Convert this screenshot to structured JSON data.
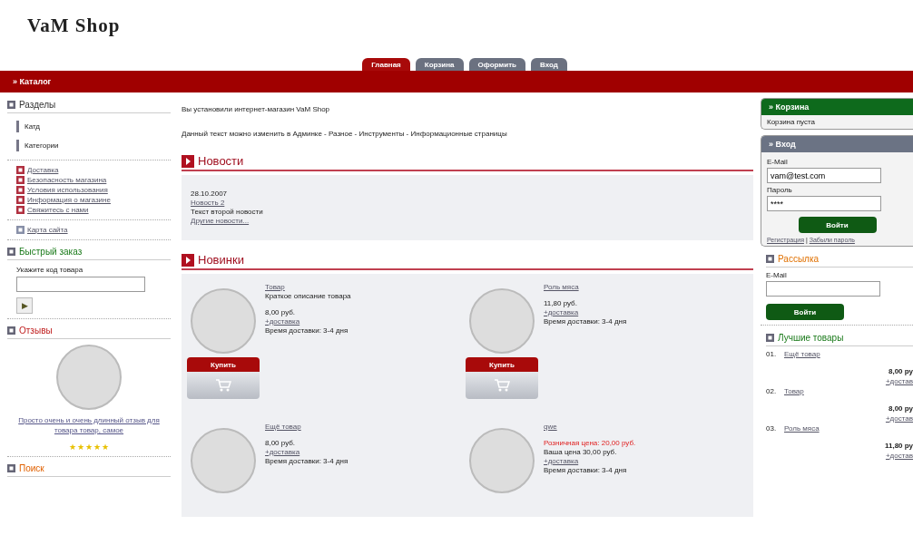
{
  "logo": "VaM Shop",
  "tabs": [
    {
      "label": "Главная",
      "selected": true
    },
    {
      "label": "Корзина",
      "selected": false
    },
    {
      "label": "Оформить",
      "selected": false
    },
    {
      "label": "Вход",
      "selected": false
    }
  ],
  "catalog_bar": "» Каталог",
  "left": {
    "sections_title": "Разделы",
    "categories": [
      "Катд",
      "Категории"
    ],
    "info_links": [
      "Доставка",
      "Безопасность магазина",
      "Условия использования",
      "Информация о магазине",
      "Свяжитесь с нами"
    ],
    "sitemap": "Карта сайта",
    "quick_order": {
      "title": "Быстрый заказ",
      "label": "Укажите код товара",
      "button": "▶"
    },
    "reviews": {
      "title": "Отзывы",
      "text": "Просто очень и очень длинный отзыв для товара товар, самое",
      "stars": 5
    },
    "search_title": "Поиск"
  },
  "center": {
    "intro": [
      "Вы установили интернет-магазин VaM Shop",
      "Данный текст можно изменить в Админке - Разное - Инструменты - Информационные страницы"
    ],
    "news": {
      "title": "Новости",
      "date": "28.10.2007",
      "headline": "Новость 2",
      "text": "Текст второй новости",
      "more": "Другие новости..."
    },
    "new_products": {
      "title": "Новинки",
      "items": [
        {
          "name": "Товар",
          "description": "Краткое описание товара",
          "price": "8,00 руб.",
          "shipping": "+доставка",
          "delivery": "Время доставки:  3-4 дня",
          "buy": "Купить"
        },
        {
          "name": "Роль мяса",
          "price": "11,80 руб.",
          "shipping": "+доставка",
          "delivery": "Время доставки:  3-4 дня",
          "buy": "Купить"
        },
        {
          "name": "Ещё товар",
          "price": "8,00 руб.",
          "shipping": "+доставка",
          "delivery": "Время доставки:  3-4 дня"
        },
        {
          "name": "qwe",
          "old_price": "Розничная цена: 20,00 руб.",
          "price": "Ваша цена 30,00 руб.",
          "shipping": "+доставка",
          "delivery": "Время доставки:  3-4 дня"
        }
      ]
    }
  },
  "right": {
    "cart": {
      "title": "» Корзина",
      "text": "Корзина пуста"
    },
    "login": {
      "title": "» Вход",
      "email_label": "E-Mail",
      "email": "vam@test.com",
      "password_label": "Пароль",
      "password": "****",
      "button": "Войти",
      "links": [
        "Регистрация",
        "Забыли пароль"
      ],
      "link_separator": "|"
    },
    "newsletter": {
      "title": "Рассылка",
      "email_label": "E-Mail",
      "button": "Войти"
    },
    "best": {
      "title": "Лучшие товары",
      "items": [
        {
          "number": "01.",
          "name": "Ещё товар",
          "price": "8,00 ру",
          "shipping": "+достав"
        },
        {
          "number": "02.",
          "name": "Товар",
          "price": "8,00 ру",
          "shipping": "+достав"
        },
        {
          "number": "03.",
          "name": "Роль мяса",
          "price": "11,80 ру",
          "shipping": "+достав"
        }
      ]
    }
  }
}
